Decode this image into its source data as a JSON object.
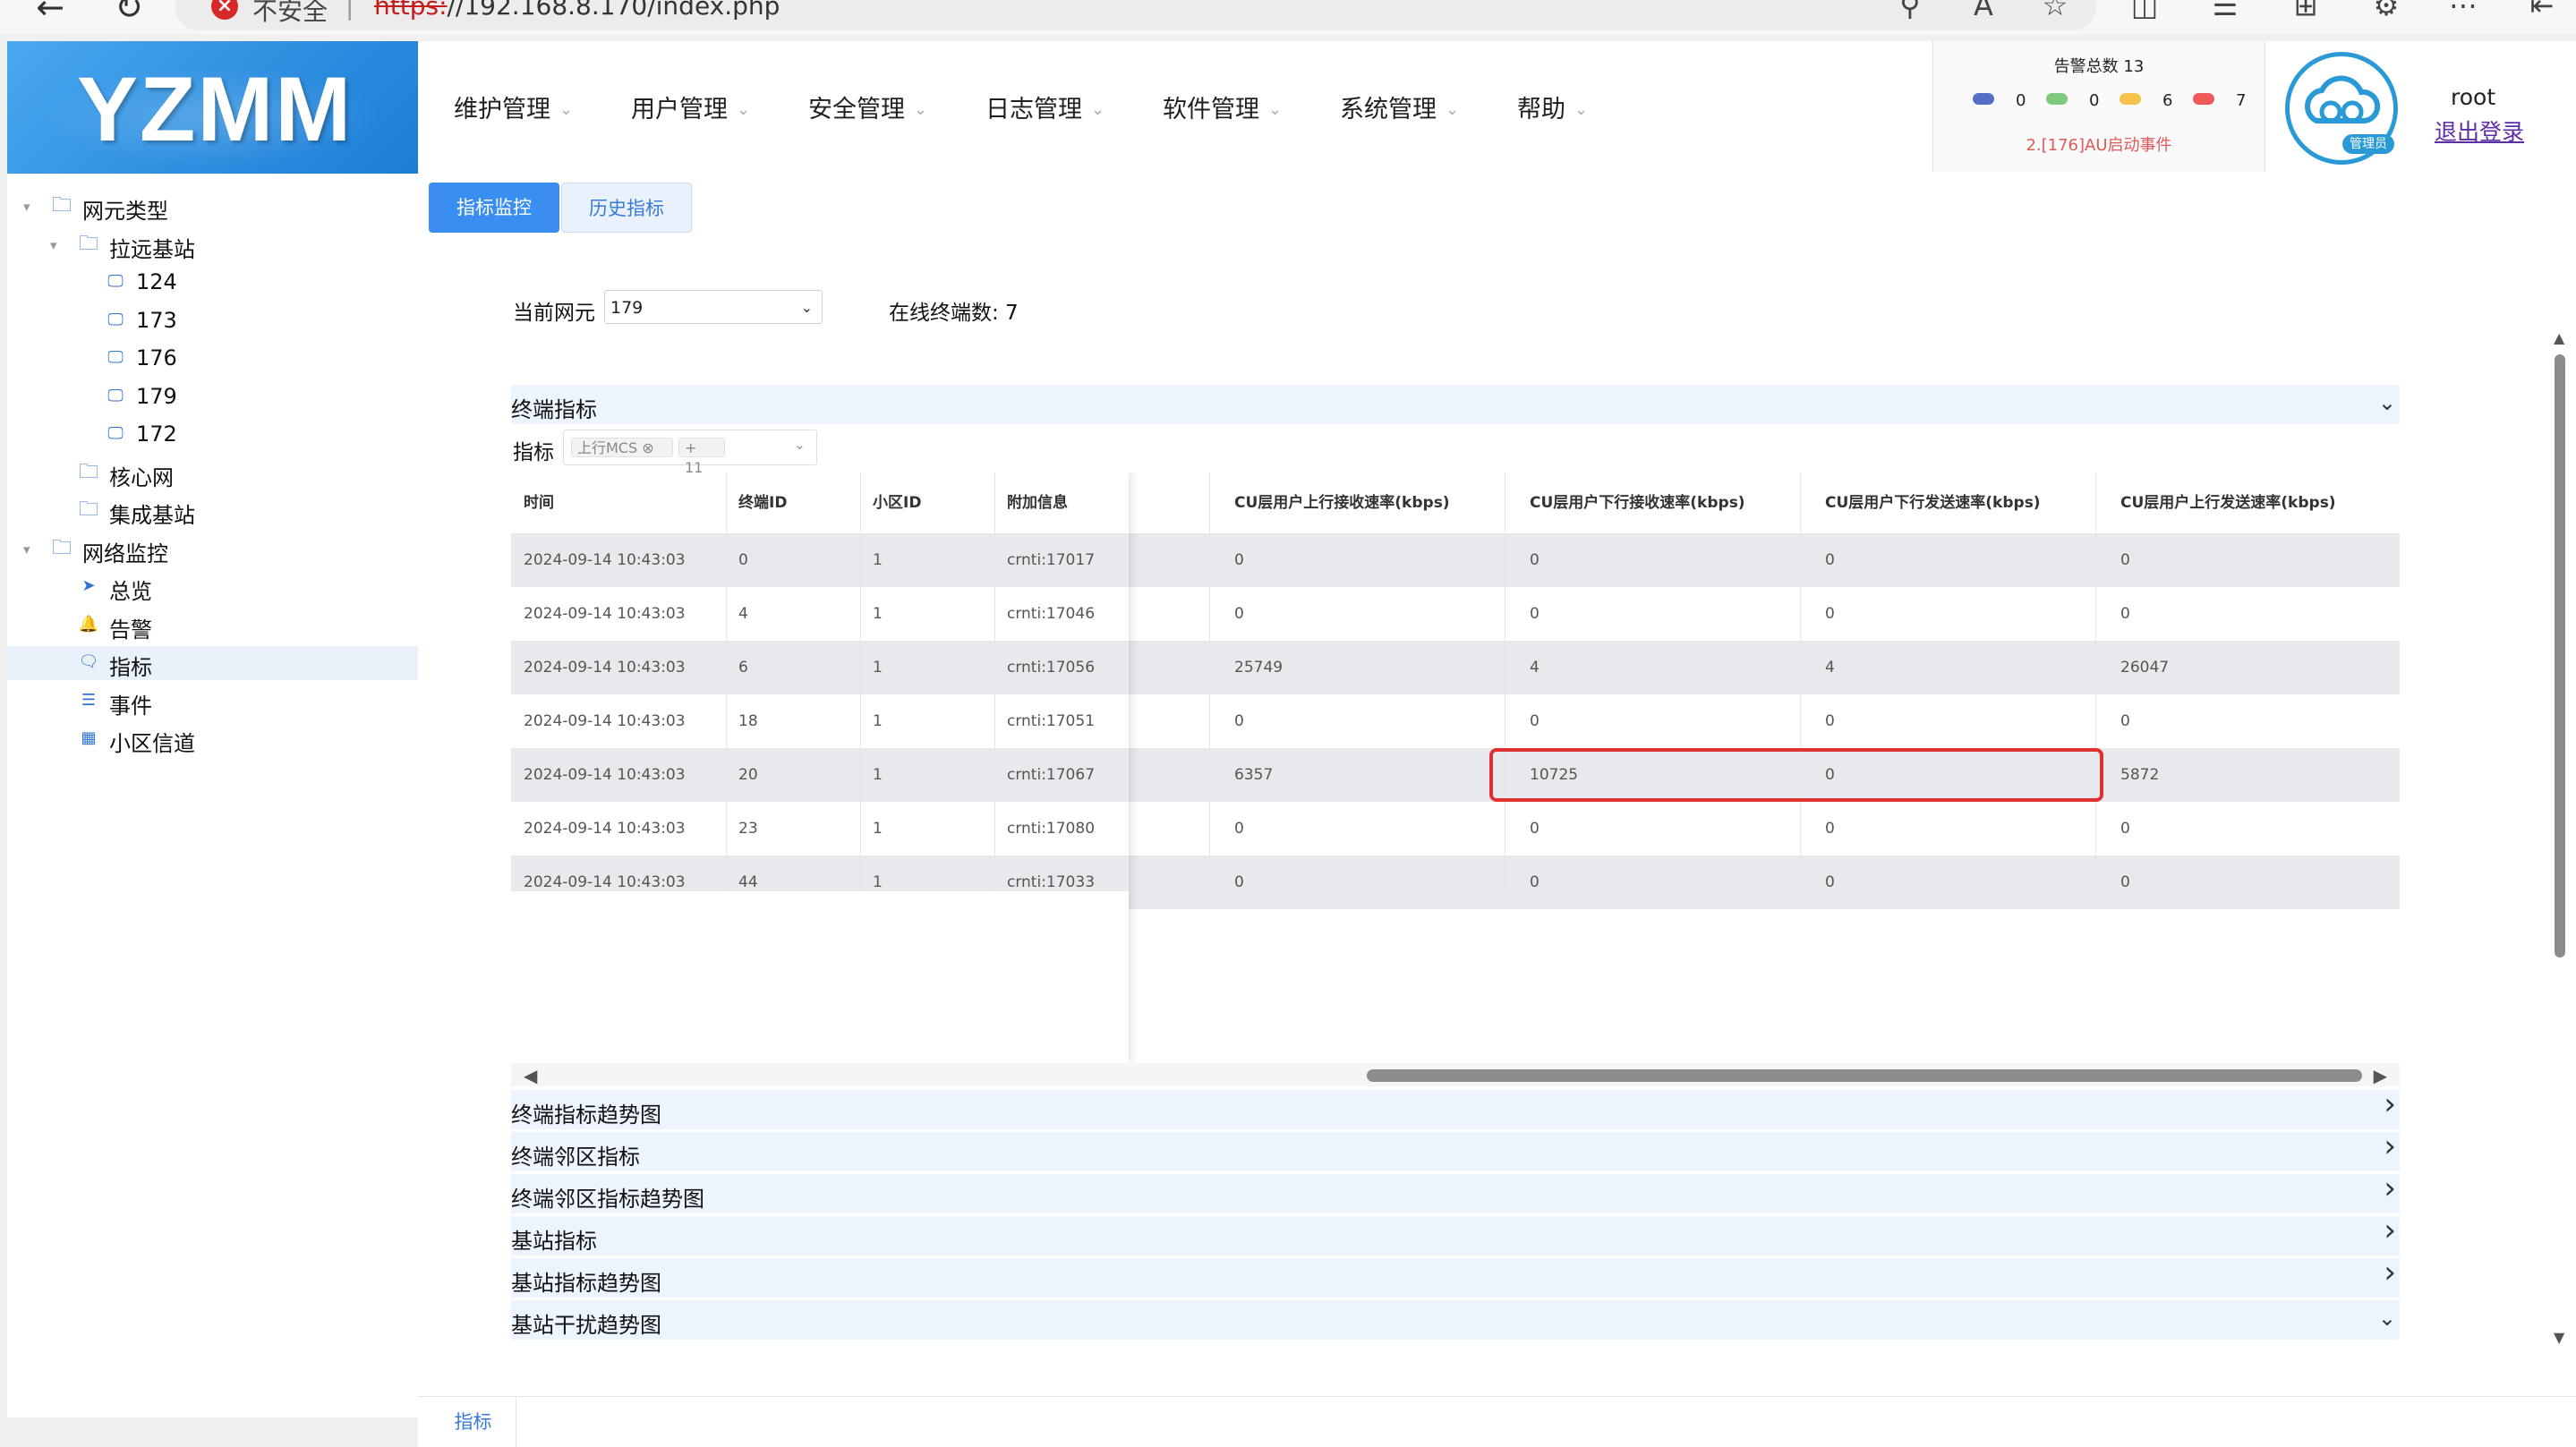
{
  "browser": {
    "insecure_label": "不安全",
    "url_scheme": "https:",
    "url_rest": "//192.168.8.170/index.php",
    "separator": "|"
  },
  "logo": "YZMM",
  "menu": [
    "维护管理",
    "用户管理",
    "安全管理",
    "日志管理",
    "软件管理",
    "系统管理",
    "帮助"
  ],
  "alarm": {
    "title": "告警总数 13",
    "levels": [
      {
        "color": "#5470c6",
        "count": "0"
      },
      {
        "color": "#7fc97f",
        "count": "0"
      },
      {
        "color": "#f7c34a",
        "count": "6"
      },
      {
        "color": "#ee5a5a",
        "count": "7"
      }
    ],
    "event": "2.[176]AU启动事件"
  },
  "user": {
    "avatar_badge": "管理员",
    "name": "root",
    "logout": "退出登录"
  },
  "tree": [
    {
      "label": "网元类型",
      "level": 0,
      "icon": "folder-icon",
      "expanded": true
    },
    {
      "label": "拉远基站",
      "level": 1,
      "icon": "folder-icon",
      "expanded": true
    },
    {
      "label": "124",
      "level": 2,
      "icon": "monitor-icon"
    },
    {
      "label": "173",
      "level": 2,
      "icon": "monitor-icon"
    },
    {
      "label": "176",
      "level": 2,
      "icon": "monitor-icon"
    },
    {
      "label": "179",
      "level": 2,
      "icon": "monitor-icon"
    },
    {
      "label": "172",
      "level": 2,
      "icon": "monitor-icon"
    },
    {
      "label": "核心网",
      "level": 1,
      "icon": "folder-icon"
    },
    {
      "label": "集成基站",
      "level": 1,
      "icon": "folder-icon"
    },
    {
      "label": "网络监控",
      "level": 0,
      "icon": "folder-icon",
      "expanded": true
    },
    {
      "label": "总览",
      "level": 1,
      "icon": "send-icon"
    },
    {
      "label": "告警",
      "level": 1,
      "icon": "bell-icon"
    },
    {
      "label": "指标",
      "level": 1,
      "icon": "chat-icon",
      "active": true
    },
    {
      "label": "事件",
      "level": 1,
      "icon": "document-icon"
    },
    {
      "label": "小区信道",
      "level": 1,
      "icon": "grid-icon"
    }
  ],
  "tabs": {
    "metrics": "指标监控",
    "history": "历史指标"
  },
  "filters": {
    "current_ne_label": "当前网元",
    "current_ne_value": "179",
    "online_label": "在线终端数: 7",
    "metric_label": "指标",
    "metric_tag": "上行MCS",
    "metric_more": "+ 11"
  },
  "sections": {
    "terminal_metrics": "终端指标",
    "collapsed": [
      "终端指标趋势图",
      "终端邻区指标",
      "终端邻区指标趋势图",
      "基站指标",
      "基站指标趋势图",
      "基站干扰趋势图"
    ]
  },
  "table": {
    "columns": [
      "时间",
      "终端ID",
      "小区ID",
      "附加信息",
      "CU层用户上行接收速率(kbps)",
      "CU层用户下行接收速率(kbps)",
      "CU层用户下行发送速率(kbps)",
      "CU层用户上行发送速率(kbps)"
    ],
    "rows": [
      [
        "2024-09-14 10:43:03",
        "0",
        "1",
        "crnti:17017",
        "0",
        "0",
        "0",
        "0"
      ],
      [
        "2024-09-14 10:43:03",
        "4",
        "1",
        "crnti:17046",
        "0",
        "0",
        "0",
        "0"
      ],
      [
        "2024-09-14 10:43:03",
        "6",
        "1",
        "crnti:17056",
        "25749",
        "4",
        "4",
        "26047"
      ],
      [
        "2024-09-14 10:43:03",
        "18",
        "1",
        "crnti:17051",
        "0",
        "0",
        "0",
        "0"
      ],
      [
        "2024-09-14 10:43:03",
        "20",
        "1",
        "crnti:17067",
        "6357",
        "10725",
        "0",
        "5872"
      ],
      [
        "2024-09-14 10:43:03",
        "23",
        "1",
        "crnti:17080",
        "0",
        "0",
        "0",
        "0"
      ],
      [
        "2024-09-14 10:43:03",
        "44",
        "1",
        "crnti:17033",
        "0",
        "0",
        "0",
        "0"
      ]
    ]
  },
  "bottom_tab": "指标"
}
